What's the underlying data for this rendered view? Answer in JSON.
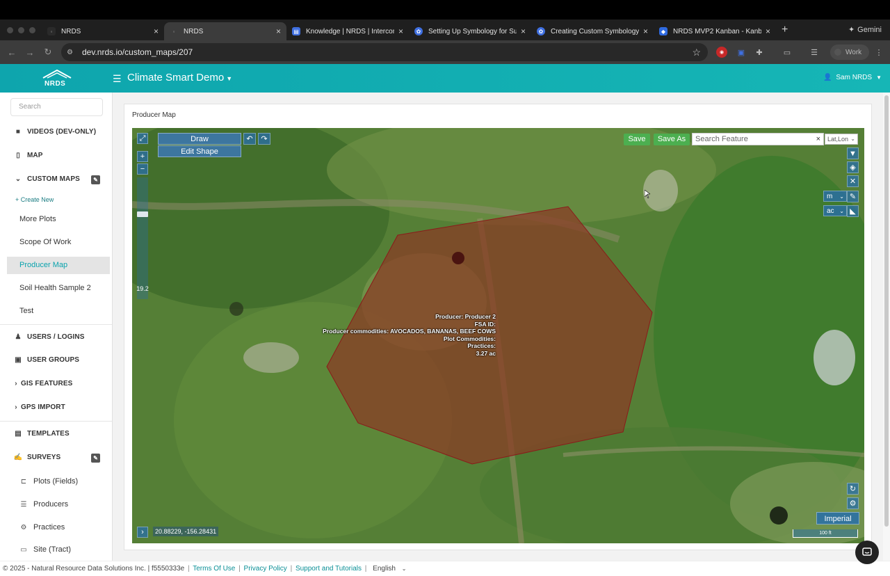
{
  "browser": {
    "tabs": [
      {
        "title": "NRDS",
        "active": false
      },
      {
        "title": "NRDS",
        "active": true
      },
      {
        "title": "Knowledge | NRDS | Intercom",
        "active": false
      },
      {
        "title": "Setting Up Symbology for Su",
        "active": false
      },
      {
        "title": "Creating Custom Symbology",
        "active": false
      },
      {
        "title": "NRDS MVP2 Kanban - Kanban",
        "active": false
      }
    ],
    "new_tab": "+",
    "gemini_label": "Gemini",
    "url": "dev.nrds.io/custom_maps/207",
    "profile_label": "Work"
  },
  "app": {
    "logo_text": "NRDS",
    "title": "Climate Smart Demo",
    "user_name": "Sam NRDS",
    "colors": {
      "brand": "#13b0b2",
      "active_text": "#0aa3ad",
      "save": "#4caf50"
    }
  },
  "sidebar": {
    "search_placeholder": "Search",
    "sections": {
      "videos": "VIDEOS (DEV-ONLY)",
      "map": "MAP",
      "custom_maps": "CUSTOM MAPS",
      "create_new": "Create New",
      "users": "USERS / LOGINS",
      "user_groups": "USER GROUPS",
      "gis": "GIS FEATURES",
      "gps": "GPS IMPORT",
      "templates": "TEMPLATES",
      "surveys": "SURVEYS"
    },
    "custom_maps": [
      "More Plots",
      "Scope Of Work",
      "Producer Map",
      "Soil Health Sample 2",
      "Test"
    ],
    "active_map": "Producer Map",
    "survey_items": [
      "Plots (Fields)",
      "Producers",
      "Practices",
      "Site (Tract)"
    ]
  },
  "page": {
    "card_title": "Producer Map"
  },
  "map": {
    "draw_label": "Draw",
    "edit_shape_label": "Edit Shape",
    "save_label": "Save",
    "save_as_label": "Save As",
    "search_placeholder": "Search Feature",
    "clear_label": "×",
    "coord_format": "Lat,Lon",
    "zoom_in": "+",
    "zoom_out": "−",
    "zoom_level": "19.2",
    "length_unit": "m",
    "area_unit": "ac",
    "coordinates": "20.88229, -156.28431",
    "units_toggle": "Imperial",
    "scale_label": "100 ft",
    "plot_label": {
      "producer": "Producer: Producer 2",
      "fsa_id": "FSA ID:",
      "commodities": "Producer commodities: AVOCADOS, BANANAS, BEEF COWS",
      "plot_commodities": "Plot Commodities:",
      "practices": "Practices:",
      "area": "3.27 ac"
    }
  },
  "footer": {
    "copyright": "© 2025 - Natural Resource Data Solutions Inc. | f5550333e",
    "terms": "Terms Of Use",
    "privacy": "Privacy Policy",
    "support": "Support and Tutorials",
    "language": "English"
  }
}
